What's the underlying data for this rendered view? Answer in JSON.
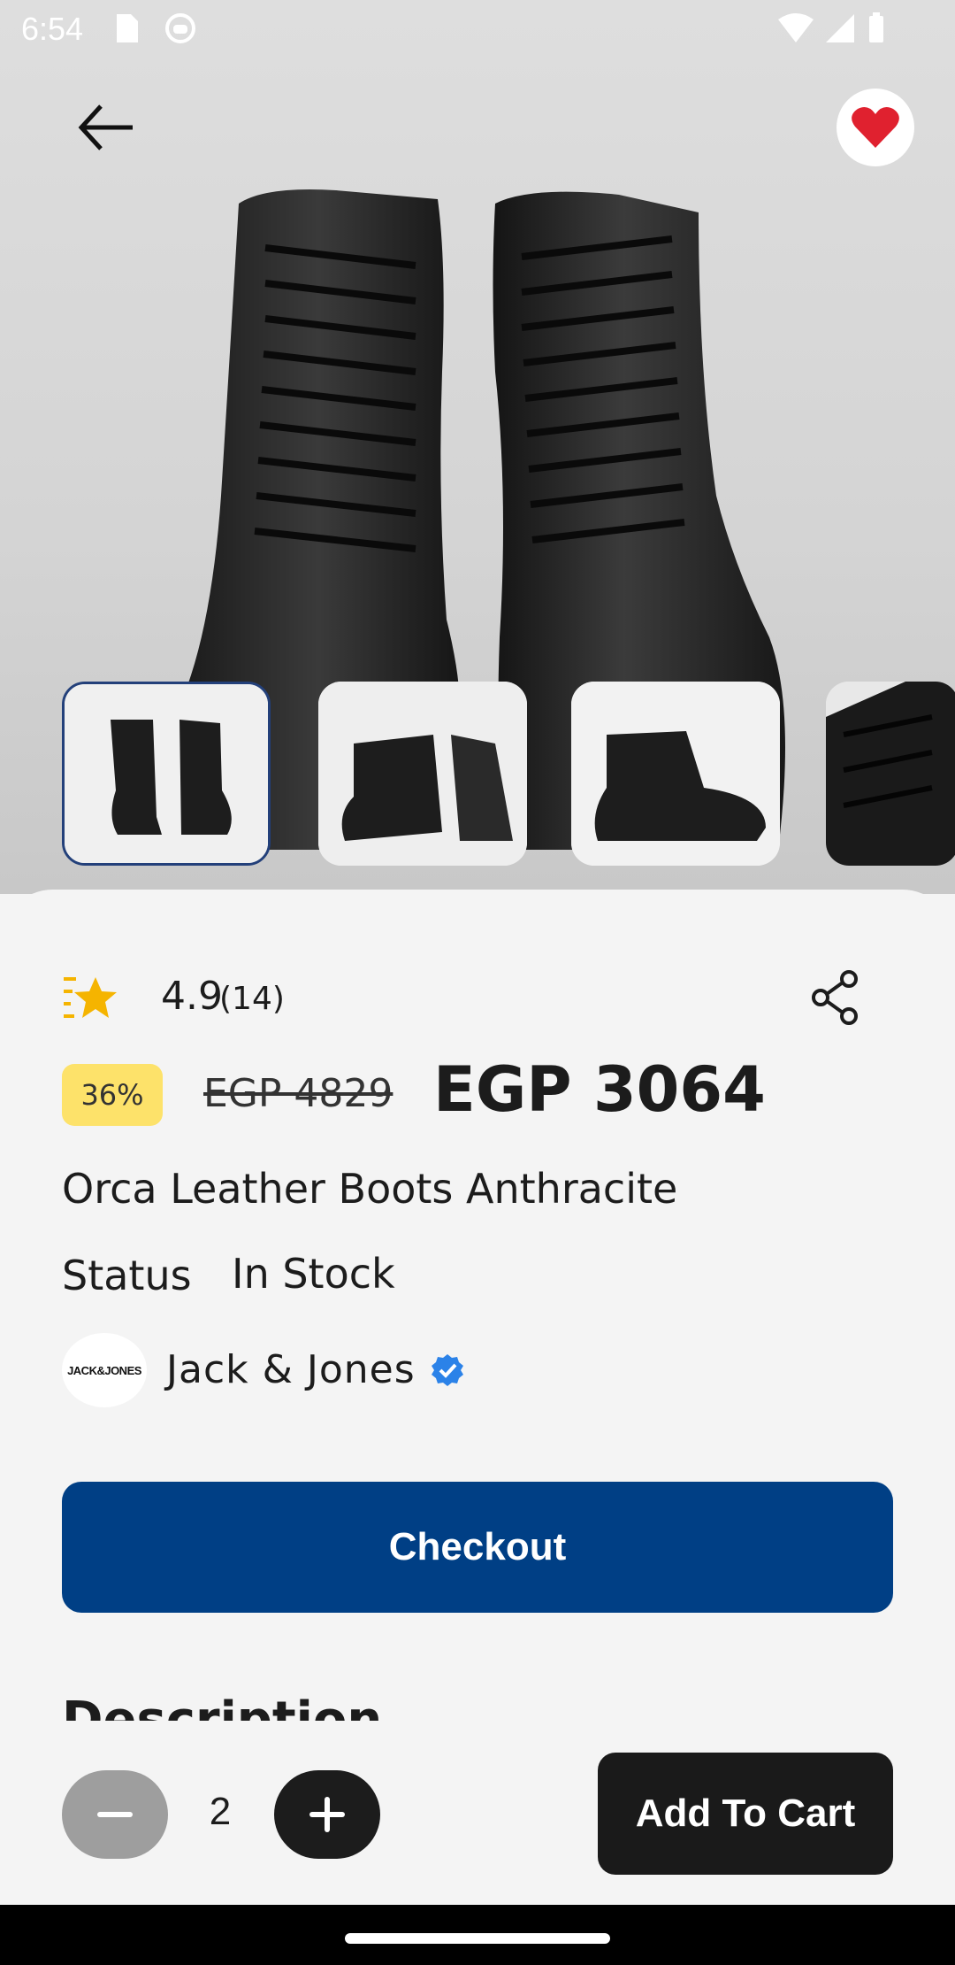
{
  "status_bar": {
    "time": "6:54"
  },
  "colors": {
    "accent": "#003f85",
    "discount_badge": "#fde26a",
    "favorite": "#e0212f",
    "verified": "#2b82e8"
  },
  "header": {
    "back_icon": "arrow-left-icon",
    "favorite_icon": "heart-icon",
    "favorited": true
  },
  "gallery": {
    "thumbnails": [
      "front pair",
      "angled pair",
      "side view",
      "detail view"
    ],
    "selected_index": 0
  },
  "rating": {
    "value": "4.9",
    "count": "(14)",
    "icon": "star-icon"
  },
  "share_icon": "share-icon",
  "pricing": {
    "discount": "36%",
    "old_price": "EGP 4829",
    "new_price": "EGP 3064"
  },
  "product": {
    "name": "Orca Leather Boots Anthracite"
  },
  "stock": {
    "label": "Status",
    "value": "In Stock"
  },
  "brand": {
    "logo_text": "JACK&JONES",
    "name": "Jack & Jones",
    "verified_icon": "verified-badge-icon"
  },
  "actions": {
    "checkout_label": "Checkout",
    "add_to_cart_label": "Add To Cart"
  },
  "description": {
    "title": "Description"
  },
  "quantity": {
    "value": "2",
    "minus_icon": "minus-icon",
    "plus_icon": "plus-icon"
  }
}
